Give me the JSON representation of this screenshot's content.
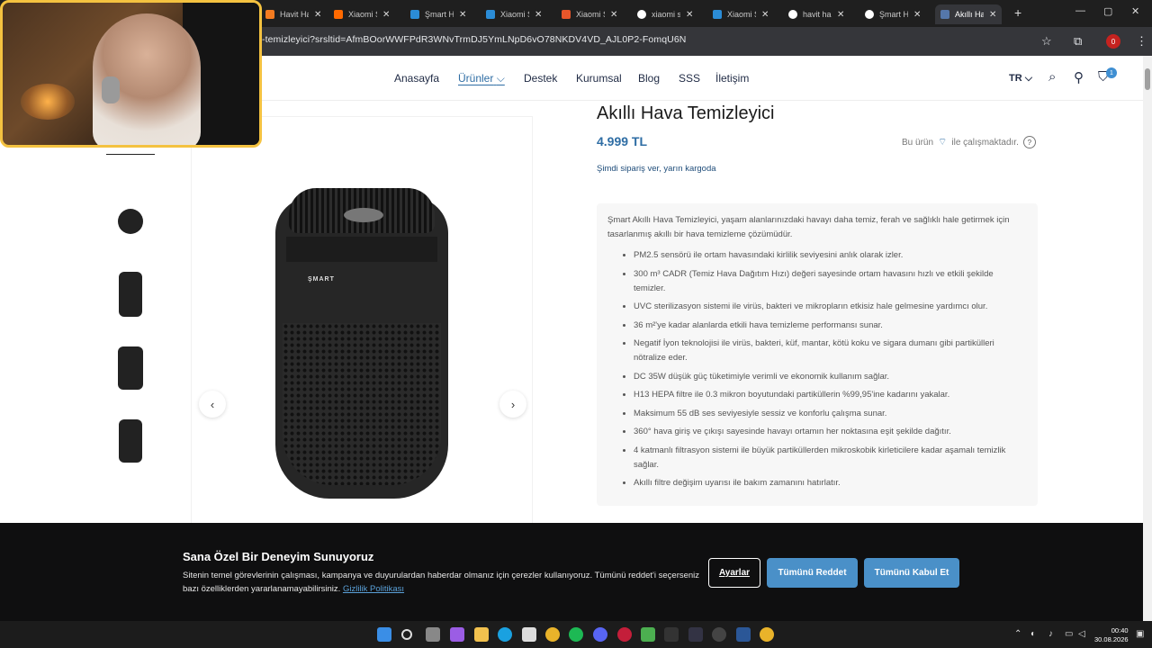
{
  "browser": {
    "tabs": [
      {
        "label": "Havit Hap",
        "color": "#f47b20"
      },
      {
        "label": "Xiaomi S",
        "color": "#ff6900"
      },
      {
        "label": "Şmart H",
        "color": "#2b8cd6"
      },
      {
        "label": "Xiaomi S",
        "color": "#2b8cd6"
      },
      {
        "label": "Xiaomi S",
        "color": "#e8562a"
      },
      {
        "label": "xiaomi s",
        "color": "#ffffff"
      },
      {
        "label": "Xiaomi S",
        "color": "#2b8cd6"
      },
      {
        "label": "havit ha",
        "color": "#ffffff"
      },
      {
        "label": "Şmart H",
        "color": "#ffffff"
      },
      {
        "label": "Akıllı Ha",
        "color": "#5577aa"
      }
    ],
    "url": "-temizleyici?srsltid=AfmBOorWWFPdR3WNvTrmDJ5YmLNpD6vO78NKDV4VD_AJL0P2-FomqU6N",
    "profile_badge": "0"
  },
  "nav": {
    "items": [
      "Anasayfa",
      "Ürünler",
      "Destek",
      "Kurumsal",
      "Blog",
      "SSS",
      "İletişim"
    ],
    "lang": "TR",
    "cart_count": "1"
  },
  "product": {
    "title": "Akıllı Hava Temizleyici",
    "price": "4.999 TL",
    "works_prefix": "Bu ürün",
    "works_suffix": "ile çalışmaktadır.",
    "shipping": "Şimdi sipariş ver, yarın kargoda",
    "brand_mark": "ŞMART",
    "intro": "Şmart Akıllı Hava Temizleyici, yaşam alanlarınızdaki havayı daha temiz, ferah ve sağlıklı hale getirmek için tasarlanmış akıllı bir hava temizleme çözümüdür.",
    "features": [
      "PM2.5 sensörü ile ortam havasındaki kirlilik seviyesini anlık olarak izler.",
      "300 m³ CADR (Temiz Hava Dağıtım Hızı) değeri sayesinde ortam havasını hızlı ve etkili şekilde temizler.",
      "UVC sterilizasyon sistemi ile virüs, bakteri ve mikropların etkisiz hale gelmesine yardımcı olur.",
      "36 m²'ye kadar alanlarda etkili hava temizleme performansı sunar.",
      "Negatif İyon teknolojisi ile virüs, bakteri, küf, mantar, kötü koku ve sigara dumanı gibi partikülleri nötralize eder.",
      "DC 35W düşük güç tüketimiyle verimli ve ekonomik kullanım sağlar.",
      "H13 HEPA filtre ile 0.3 mikron boyutundaki partiküllerin %99,95'ine kadarını yakalar.",
      "Maksimum 55 dB ses seviyesiyle sessiz ve konforlu çalışma sunar.",
      "360° hava giriş ve çıkışı sayesinde havayı ortamın her noktasına eşit şekilde dağıtır.",
      "4 katmanlı filtrasyon sistemi ile büyük partiküllerden mikroskobik kirleticilere kadar aşamalı temizlik sağlar.",
      "Akıllı filtre değişim uyarısı ile bakım zamanını hatırlatır."
    ]
  },
  "cookie": {
    "heading": "Sana Özel Bir Deneyim Sunuyoruz",
    "body": "Sitenin temel görevlerinin çalışması, kampanya ve duyurulardan haberdar olmanız için çerezler kullanıyoruz. Tümünü reddet'i seçerseniz bazı özelliklerden yararlanamayabilirsiniz.",
    "link": "Gizlilik Politikası",
    "settings": "Ayarlar",
    "reject": "Tümünü Reddet",
    "accept": "Tümünü Kabul Et"
  },
  "taskbar": {
    "time": "00:40",
    "date": "30.08.2026"
  }
}
